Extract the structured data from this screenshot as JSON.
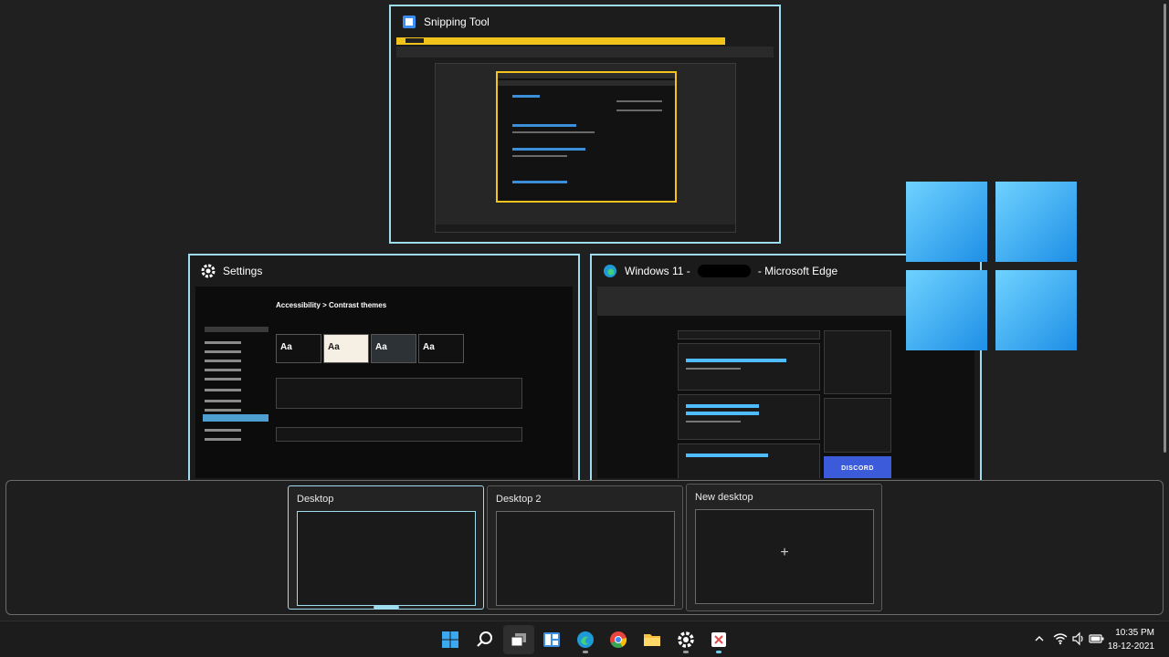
{
  "windows": {
    "snipping": {
      "title": "Snipping Tool"
    },
    "settings": {
      "title": "Settings",
      "breadcrumb": "Accessibility  >  Contrast themes",
      "themes": [
        "Aa",
        "Aa",
        "Aa",
        "Aa"
      ]
    },
    "edge": {
      "title": "Windows 11 - ",
      "title_suffix": " - Microsoft Edge",
      "discord": "DISCORD"
    }
  },
  "desktops": [
    {
      "label": "Desktop",
      "active": true
    },
    {
      "label": "Desktop 2",
      "active": false
    },
    {
      "label": "New desktop",
      "plus": "+"
    }
  ],
  "taskbar": {
    "apps": [
      "start-icon",
      "search-icon",
      "task-view-icon",
      "widgets-icon",
      "edge-icon",
      "chrome-icon",
      "file-explorer-icon",
      "settings-icon",
      "snipping-tool-icon"
    ],
    "clock": {
      "time": "10:35 PM",
      "date": "18-12-2021"
    }
  },
  "colors": {
    "accent": "#9fdcef",
    "background": "#202020",
    "taskbar": "#1c1c1c",
    "yellow": "#f2c31b"
  }
}
